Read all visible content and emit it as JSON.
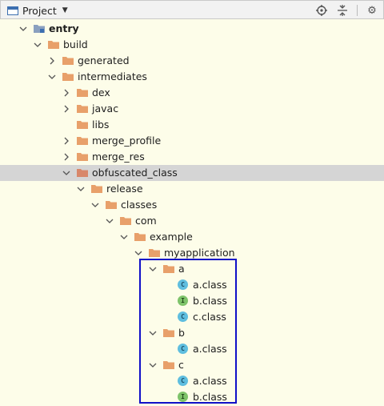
{
  "toolbar": {
    "title": "Project",
    "icons": [
      "project-window-icon",
      "dropdown-triangle-icon",
      "locate-icon",
      "collapse-all-icon",
      "settings-gear-icon"
    ]
  },
  "colors": {
    "folder": "#e8a06a",
    "module": "#6e8fbf",
    "class_c": "#5fbedf",
    "class_i": "#7ec36a",
    "highlight": "#1010c8",
    "selected_row": "#d5d5d5"
  },
  "tree": {
    "entry": "entry",
    "build": "build",
    "generated": "generated",
    "intermediates": "intermediates",
    "dex": "dex",
    "javac": "javac",
    "libs": "libs",
    "merge_profile": "merge_profile",
    "merge_res": "merge_res",
    "obfuscated_class": "obfuscated_class",
    "release": "release",
    "classes": "classes",
    "com": "com",
    "example": "example",
    "myapplication": "myapplication",
    "pkg_a": "a",
    "a_a": "a.class",
    "a_b": "b.class",
    "a_c": "c.class",
    "pkg_b": "b",
    "b_a": "a.class",
    "pkg_c": "c",
    "c_a": "a.class",
    "c_b": "b.class"
  },
  "badges": {
    "class": "C",
    "interface": "I"
  }
}
